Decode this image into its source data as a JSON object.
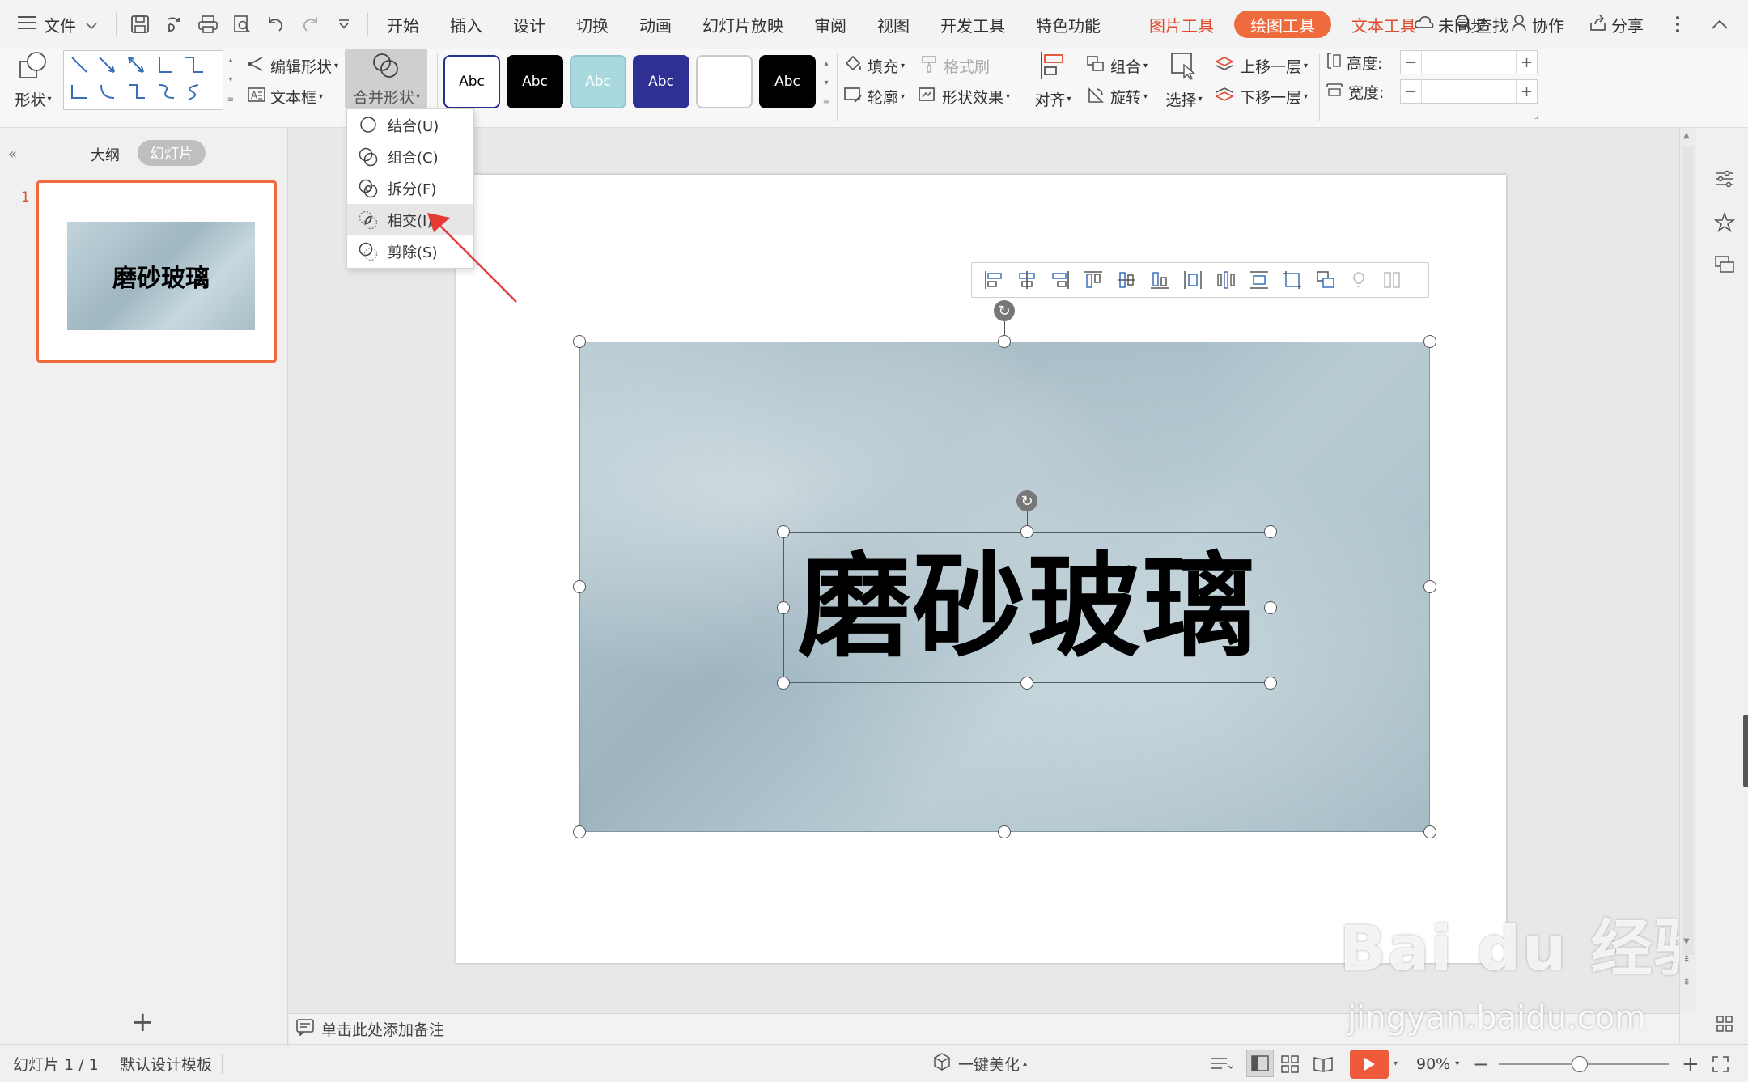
{
  "menubar": {
    "file": "文件",
    "tabs": [
      "开始",
      "插入",
      "设计",
      "切换",
      "动画",
      "幻灯片放映",
      "审阅",
      "视图",
      "开发工具",
      "特色功能"
    ],
    "context_picture": "图片工具",
    "context_drawing": "绘图工具",
    "context_text": "文本工具",
    "search": "查找",
    "sync": "未同步",
    "collab": "协作",
    "share": "分享"
  },
  "ribbon": {
    "shape": "形状",
    "edit_shape": "编辑形状",
    "textbox": "文本框",
    "merge_shape": "合并形状",
    "style_sample": "Abc",
    "styles": [
      {
        "bg": "#ffffff",
        "fg": "#000000",
        "border": "#2a2e8c",
        "label": "Abc"
      },
      {
        "bg": "#000000",
        "fg": "#ffffff",
        "border": "#000000",
        "label": "Abc"
      },
      {
        "bg": "#a9d9de",
        "fg": "#ffffff",
        "border": "#8cc4ca",
        "label": "Abc"
      },
      {
        "bg": "#2f2f94",
        "fg": "#ffffff",
        "border": "#2f2f94",
        "label": "Abc"
      },
      {
        "bg": "#ffffff",
        "fg": "#ffffff",
        "border": "#c9c9c9",
        "label": ""
      },
      {
        "bg": "#000000",
        "fg": "#ffffff",
        "border": "#000000",
        "label": "Abc"
      }
    ],
    "fill": "填充",
    "format_painter": "格式刷",
    "outline": "轮廓",
    "shape_effect": "形状效果",
    "align": "对齐",
    "group": "组合",
    "rotate": "旋转",
    "select": "选择",
    "bring_forward": "上移一层",
    "send_backward": "下移一层",
    "height_label": "高度:",
    "width_label": "宽度:",
    "minus": "−",
    "plus": "+"
  },
  "dropdown": {
    "items": [
      {
        "label": "结合(U)"
      },
      {
        "label": "组合(C)"
      },
      {
        "label": "拆分(F)"
      },
      {
        "label": "相交(I)"
      },
      {
        "label": "剪除(S)"
      }
    ]
  },
  "leftpanel": {
    "tab_outline": "大纲",
    "tab_slides": "幻灯片",
    "slide_number": "1",
    "thumb_text": "磨砂玻璃",
    "add": "+"
  },
  "slide": {
    "text": "磨砂玻璃"
  },
  "notes": {
    "placeholder": "单击此处添加备注"
  },
  "watermark": {
    "brand": "Bai du 经验",
    "url": "jingyan.baidu.com"
  },
  "statusbar": {
    "slide_info": "幻灯片 1 / 1",
    "template": "默认设计模板",
    "beautify": "一键美化",
    "zoom": "90%"
  },
  "colors": {
    "accent": "#ef6a3c",
    "context_tab": "#e24a2c",
    "arrow": "#e53935"
  }
}
